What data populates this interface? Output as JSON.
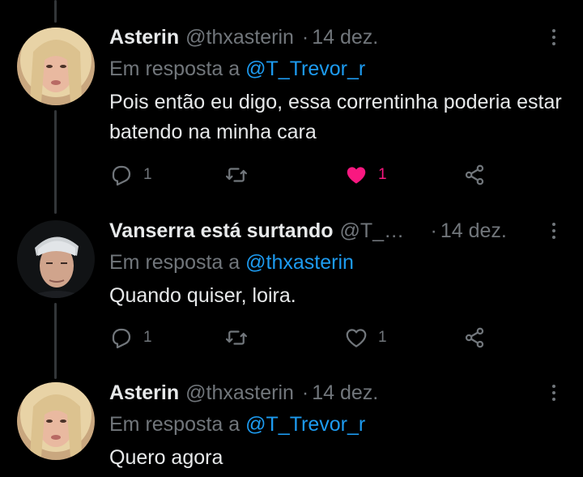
{
  "colors": {
    "background": "#000000",
    "text": "#e7e9ea",
    "secondary": "#71767b",
    "link": "#1d9bf0",
    "like": "#f91880",
    "thread_line": "#333639"
  },
  "tweets": [
    {
      "name": "Asterin",
      "handle": "@thxasterin",
      "separator": "·",
      "date": "14 dez.",
      "reply_prefix": "Em resposta a",
      "reply_mention": "@T_Trevor_r",
      "text": "Pois então eu digo, essa correntinha poderia estar batendo na minha cara",
      "reply_count": "1",
      "like_count": "1",
      "liked": true,
      "icons": [
        "reply-icon",
        "retweet-icon",
        "like-icon",
        "share-icon",
        "more-icon"
      ]
    },
    {
      "name": "Vanserra está surtando",
      "handle": "@T_Trevor_r",
      "separator": "·",
      "date": "14 dez.",
      "reply_prefix": "Em resposta a",
      "reply_mention": "@thxasterin",
      "text": "Quando quiser, loira.",
      "reply_count": "1",
      "like_count": "1",
      "liked": false,
      "icons": [
        "reply-icon",
        "retweet-icon",
        "like-icon",
        "share-icon",
        "more-icon"
      ]
    },
    {
      "name": "Asterin",
      "handle": "@thxasterin",
      "separator": "·",
      "date": "14 dez.",
      "reply_prefix": "Em resposta a",
      "reply_mention": "@T_Trevor_r",
      "text": "Quero agora",
      "icons": [
        "more-icon"
      ]
    }
  ]
}
